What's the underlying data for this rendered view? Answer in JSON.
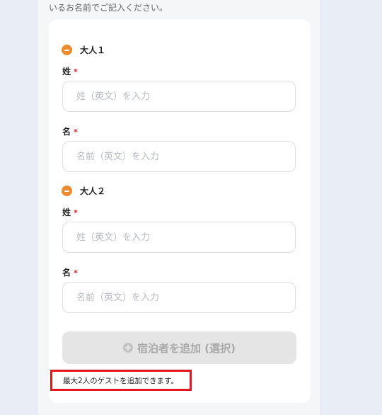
{
  "instruction_text": "いるお名前でご記入ください。",
  "guests": [
    {
      "title": "大人１",
      "last_name": {
        "label": "姓",
        "required_mark": "*",
        "placeholder": "姓（英文）を入力"
      },
      "first_name": {
        "label": "名",
        "required_mark": "*",
        "placeholder": "名前（英文）を入力"
      }
    },
    {
      "title": "大人２",
      "last_name": {
        "label": "姓",
        "required_mark": "*",
        "placeholder": "姓（英文）を入力"
      },
      "first_name": {
        "label": "名",
        "required_mark": "*",
        "placeholder": "名前（英文）を入力"
      }
    }
  ],
  "add_guest_button": {
    "label": "宿泊者を追加 (選択)",
    "icon": "plus-circle-icon",
    "enabled": false
  },
  "max_guest_note": "最大2人のゲストを追加できます。",
  "colors": {
    "accent": "#ee8a2e",
    "required": "#e0202a",
    "highlight_border": "#e3171c"
  }
}
